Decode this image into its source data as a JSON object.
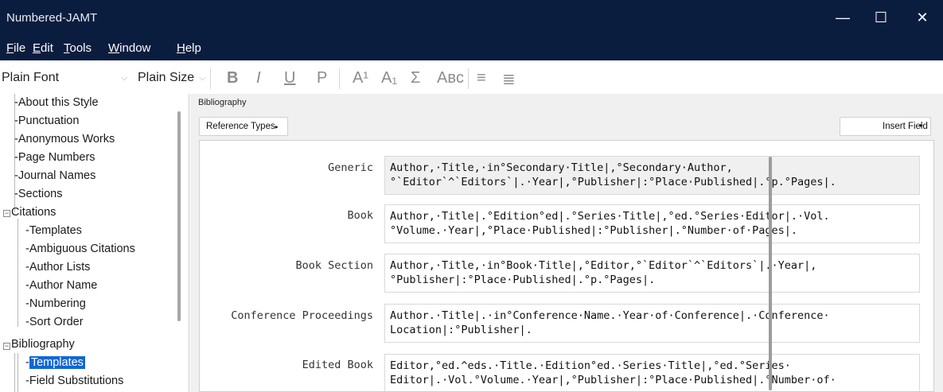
{
  "window": {
    "title": "Numbered-JAMT",
    "minimize": "—",
    "maximize": "☐",
    "close": "✕"
  },
  "menu": [
    {
      "key": "F",
      "rest": "ile"
    },
    {
      "key": "E",
      "rest": "dit"
    },
    {
      "key": "T",
      "rest": "ools"
    },
    {
      "key": "W",
      "rest": "indow"
    },
    {
      "key": "H",
      "rest": "elp"
    }
  ],
  "toolbar": {
    "font": "Plain Font",
    "size": "Plain Size",
    "bold": "B",
    "italic": "I",
    "underline": "U",
    "plain": "P",
    "superscript": "A¹",
    "subscript": "A₁",
    "symbol": "Σ",
    "smallcaps": "Aʙᴄ",
    "align_left": "≡",
    "justify": "≣"
  },
  "tree": {
    "items": [
      "About this Style",
      "Punctuation",
      "Anonymous Works",
      "Page Numbers",
      "Journal Names",
      "Sections",
      "Citations",
      "Templates",
      "Ambiguous Citations",
      "Author Lists",
      "Author Name",
      "Numbering",
      "Sort Order",
      "Bibliography",
      "Templates",
      "Field Substitutions"
    ],
    "selected_index": 14
  },
  "panel": {
    "title": "Bibliography",
    "reference_types": "Reference Types",
    "insert_field": "Insert Field"
  },
  "rows": [
    {
      "label": "Generic",
      "line1": "Author,·Title,·in°Secondary·Title|,°Secondary·Author,",
      "line2": "°`Editor`^`Editors`|.·Year|,°Publisher|:°Place·Published|.°p.°Pages|."
    },
    {
      "label": "Book",
      "line1": "Author,·Title|.°Edition°ed|.°Series·Title|,°ed.°Series·Editor|.·Vol.",
      "line2": "°Volume.·Year|,°Place·Published|:°Publisher|.°Number·of·Pages|."
    },
    {
      "label": "Book Section",
      "line1": "Author,·Title,·in°Book·Title|,°Editor,°`Editor`^`Editors`|.·Year|,",
      "line2": "°Publisher|:°Place·Published|.°p.°Pages|."
    },
    {
      "label": "Conference Proceedings",
      "line1": "Author.·Title|.·in°Conference·Name.·Year·of·Conference|.·Conference·",
      "line2": "Location|:°Publisher|."
    },
    {
      "label": "Edited Book",
      "line1": "Editor,°ed.^eds.·Title.·Edition°ed.·Series·Title|,°ed.°Series·",
      "line2": "Editor|.·Vol.°Volume.·Year|,°Publisher|:°Place·Published|.°Number·of·"
    }
  ]
}
